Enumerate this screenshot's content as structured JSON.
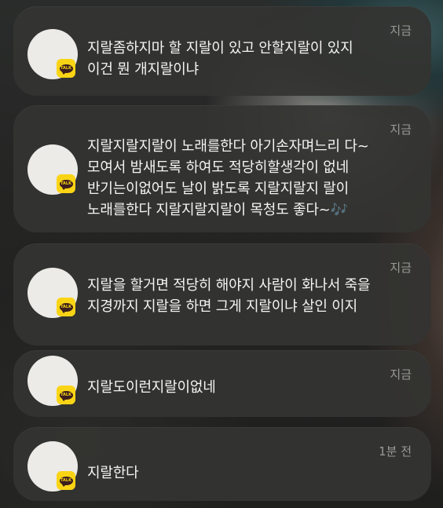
{
  "notifications": [
    {
      "app": "TALK",
      "time": "지금",
      "message": "지랄좀하지마 할 지랄이 있고 안할지랄이 있지\n이건 뭔 개지랄이냐"
    },
    {
      "app": "TALK",
      "time": "지금",
      "message": "지랄지랄지랄이 노래를한다 아기손자며느리 다~\n모여서 밤새도록 하여도 적당히할생각이 없네\n반기는이없어도 날이 밝도록 지랄지랄지 랄이\n노래를한다 지랄지랄지랄이 목청도 좋다~🎶"
    },
    {
      "app": "TALK",
      "time": "지금",
      "message": "지랄을 할거면 적당히 해야지 사람이 화나서 죽을\n지경까지 지랄을 하면 그게 지랄이냐 살인 이지"
    },
    {
      "app": "TALK",
      "time": "지금",
      "message": "지랄도이런지랄이없네"
    },
    {
      "app": "TALK",
      "time": "1분 전",
      "message": "지랄한다"
    }
  ],
  "colors": {
    "card_bg": "#343432",
    "badge_yellow": "#f9d415",
    "badge_brown": "#3a1d1d",
    "text": "#f4f4f2",
    "time_text": "#9a9a96"
  },
  "icons": {
    "avatar": "profile-avatar-placeholder",
    "badge": "kakaotalk-talk-badge-icon"
  }
}
